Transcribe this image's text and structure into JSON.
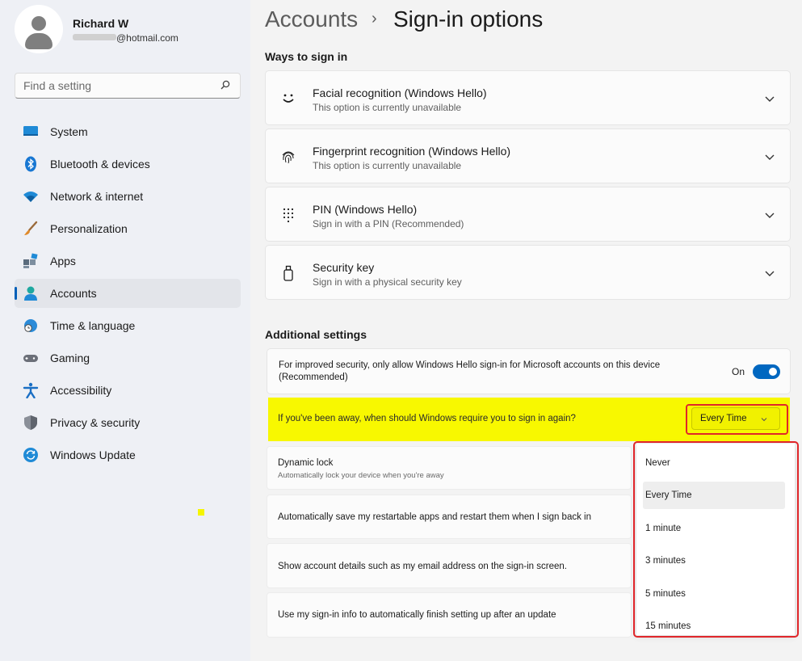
{
  "user": {
    "name": "Richard W",
    "email": "@hotmail.com"
  },
  "search": {
    "placeholder": "Find a setting"
  },
  "sidebar": {
    "items": [
      {
        "label": "System",
        "icon": "display-icon"
      },
      {
        "label": "Bluetooth & devices",
        "icon": "bluetooth-icon"
      },
      {
        "label": "Network & internet",
        "icon": "wifi-icon"
      },
      {
        "label": "Personalization",
        "icon": "brush-icon"
      },
      {
        "label": "Apps",
        "icon": "apps-icon"
      },
      {
        "label": "Accounts",
        "icon": "person-icon",
        "active": true
      },
      {
        "label": "Time & language",
        "icon": "globe-clock-icon"
      },
      {
        "label": "Gaming",
        "icon": "gamepad-icon"
      },
      {
        "label": "Accessibility",
        "icon": "accessibility-icon"
      },
      {
        "label": "Privacy & security",
        "icon": "shield-icon"
      },
      {
        "label": "Windows Update",
        "icon": "refresh-icon"
      }
    ]
  },
  "breadcrumb": {
    "parent": "Accounts",
    "separator": "›",
    "current": "Sign-in options"
  },
  "ways": {
    "title": "Ways to sign in",
    "items": [
      {
        "title": "Facial recognition (Windows Hello)",
        "subtitle": "This option is currently unavailable",
        "icon": "smile-icon"
      },
      {
        "title": "Fingerprint recognition (Windows Hello)",
        "subtitle": "This option is currently unavailable",
        "icon": "fingerprint-icon"
      },
      {
        "title": "PIN (Windows Hello)",
        "subtitle": "Sign in with a PIN (Recommended)",
        "icon": "keypad-icon"
      },
      {
        "title": "Security key",
        "subtitle": "Sign in with a physical security key",
        "icon": "usb-key-icon"
      }
    ]
  },
  "additional": {
    "title": "Additional settings",
    "hello_only": {
      "text_line1": "For improved security, only allow Windows Hello sign-in for Microsoft accounts on this device",
      "text_line2": "(Recommended)",
      "state_label": "On"
    },
    "away": {
      "question": "If you've been away, when should Windows require you to sign in again?",
      "selected": "Every Time",
      "options": [
        "Never",
        "Every Time",
        "1 minute",
        "3 minutes",
        "5 minutes",
        "15 minutes"
      ]
    },
    "dynamic_lock": {
      "title": "Dynamic lock",
      "subtitle": "Automatically lock your device when you're away"
    },
    "restart_apps": {
      "title": "Automatically save my restartable apps and restart them when I sign back in"
    },
    "account_details": {
      "title": "Show account details such as my email address on the sign-in screen."
    },
    "signin_info": {
      "title": "Use my sign-in info to automatically finish setting up after an update"
    }
  },
  "colors": {
    "accent": "#0067c0",
    "highlight": "#f8f800",
    "annotation_red": "#e0262a"
  }
}
